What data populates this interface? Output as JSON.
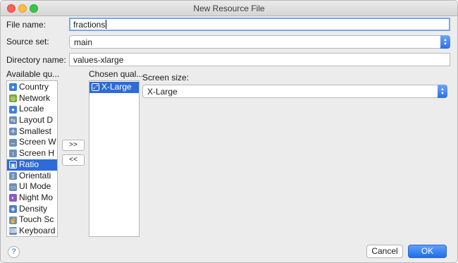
{
  "window": {
    "title": "New Resource File"
  },
  "form": {
    "file_name_label": "File name:",
    "file_name_value": "fractions",
    "source_set_label": "Source set:",
    "source_set_value": "main",
    "directory_name_label": "Directory name:",
    "directory_name_value": "values-xlarge"
  },
  "qualifiers": {
    "available_label": "Available qu...",
    "chosen_label": "Chosen qual...",
    "available_items": [
      {
        "label": "Country",
        "icon": "globe-icon",
        "color": "#3f7fd6"
      },
      {
        "label": "Network",
        "icon": "network-icon",
        "color": "#7ba832"
      },
      {
        "label": "Locale",
        "icon": "locale-globe-icon",
        "color": "#3f7fd6"
      },
      {
        "label": "Layout D",
        "icon": "layout-direction-icon",
        "color": "#6c8fb8"
      },
      {
        "label": "Smallest",
        "icon": "smallest-width-icon",
        "color": "#6c8fb8"
      },
      {
        "label": "Screen W",
        "icon": "screen-width-icon",
        "color": "#6c8fb8"
      },
      {
        "label": "Screen H",
        "icon": "screen-height-icon",
        "color": "#6c8fb8"
      },
      {
        "label": "Ratio",
        "icon": "ratio-icon",
        "color": "#ffffff"
      },
      {
        "label": "Orientati",
        "icon": "orientation-icon",
        "color": "#6c8fb8"
      },
      {
        "label": "UI Mode",
        "icon": "ui-mode-icon",
        "color": "#6c8fb8"
      },
      {
        "label": "Night Mo",
        "icon": "night-mode-icon",
        "color": "#8a5bc7"
      },
      {
        "label": "Density",
        "icon": "density-icon",
        "color": "#4e7fc1"
      },
      {
        "label": "Touch Sc",
        "icon": "touch-screen-icon",
        "color": "#6c8fb8"
      },
      {
        "label": "Keyboard",
        "icon": "keyboard-icon",
        "color": "#6c8fb8"
      }
    ],
    "available_selected": "Ratio",
    "chosen_items": [
      {
        "label": "X-Large",
        "icon": "screen-size-icon"
      }
    ],
    "add_button": ">>",
    "remove_button": "<<"
  },
  "detail": {
    "screen_size_label": "Screen size:",
    "screen_size_value": "X-Large"
  },
  "buttons": {
    "help": "?",
    "cancel": "Cancel",
    "ok": "OK"
  }
}
